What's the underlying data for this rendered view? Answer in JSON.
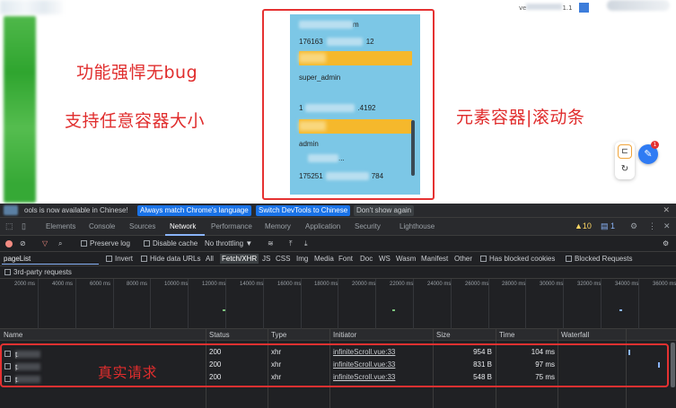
{
  "page": {
    "feature_line_1": "功能强悍无bug",
    "feature_line_2": "支持任意容器大小",
    "container_label": "元素容器|滚动条",
    "account_prefix": "ve",
    "account_suffix": "1.1",
    "list": {
      "items": [
        {
          "prefix": "",
          "suffix": "m"
        },
        {
          "prefix": "176163",
          "suffix": "12"
        },
        {
          "prefix": "super_admin",
          "suffix": ""
        },
        {
          "prefix": "1",
          "suffix": ".4192"
        },
        {
          "prefix": "admin",
          "suffix": ""
        },
        {
          "prefix": "",
          "suffix": "..."
        },
        {
          "prefix": "175251",
          "suffix": "784"
        }
      ]
    },
    "fab_badge": "1",
    "colors": {
      "container_bg": "#7cc7e6",
      "highlight_row": "#f5b82c",
      "annotation": "#e02d2d"
    }
  },
  "devtools": {
    "infobar": {
      "message": "ools is now available in Chinese!",
      "btn_match": "Always match Chrome's language",
      "btn_switch": "Switch DevTools to Chinese",
      "btn_dismiss": "Don't show again",
      "close": "✕"
    },
    "tabs": [
      "Elements",
      "Console",
      "Sources",
      "Network",
      "Performance",
      "Memory",
      "Application",
      "Security",
      "Lighthouse"
    ],
    "active_tab": "Network",
    "warnings_count": "▲10",
    "messages_count": "1",
    "toolbar": {
      "preserve_log": "Preserve log",
      "disable_cache": "Disable cache",
      "throttling": "No throttling",
      "throttling_caret": "▼"
    },
    "filter": {
      "value": "pageList",
      "invert": "Invert",
      "hide_data_urls": "Hide data URLs",
      "types": [
        "All",
        "Fetch/XHR",
        "JS",
        "CSS",
        "Img",
        "Media",
        "Font",
        "Doc",
        "WS",
        "Wasm",
        "Manifest",
        "Other"
      ],
      "selected_type": "Fetch/XHR",
      "blocked_cookies": "Has blocked cookies",
      "blocked_requests": "Blocked Requests"
    },
    "third_party": "3rd-party requests",
    "timeline_ticks": [
      "2000 ms",
      "4000 ms",
      "6000 ms",
      "8000 ms",
      "10000 ms",
      "12000 ms",
      "14000 ms",
      "16000 ms",
      "18000 ms",
      "20000 ms",
      "22000 ms",
      "24000 ms",
      "26000 ms",
      "28000 ms",
      "30000 ms",
      "32000 ms",
      "34000 ms",
      "36000 ms"
    ],
    "table": {
      "headers": [
        "Name",
        "Status",
        "Type",
        "Initiator",
        "Size",
        "Time",
        "Waterfall"
      ],
      "rows": [
        {
          "name_prefix": "p",
          "name_suffix": "t",
          "status": "200",
          "type": "xhr",
          "initiator": "infiniteScroll.vue:33",
          "size": "954 B",
          "time": "104 ms"
        },
        {
          "name_prefix": "p",
          "name_suffix": "t",
          "status": "200",
          "type": "xhr",
          "initiator": "infiniteScroll.vue:33",
          "size": "831 B",
          "time": "97 ms"
        },
        {
          "name_prefix": "p",
          "name_suffix": "t",
          "status": "200",
          "type": "xhr",
          "initiator": "infiniteScroll.vue:33",
          "size": "548 B",
          "time": "75 ms"
        }
      ]
    },
    "annotation": "真实请求"
  }
}
